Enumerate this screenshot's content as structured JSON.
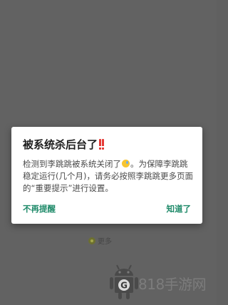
{
  "dialog": {
    "title": "被系统杀后台了",
    "title_icon": "double-exclamation-icon",
    "message_part1": "检测到李跳跳被系统关闭了",
    "message_emoji": "sweat-smile-emoji",
    "message_part2": "。为保障李跳跳稳定运行(几个月)，请务必按照李跳跳更多页面的“重要提示”进行设置。",
    "negative_button": "不再提醒",
    "positive_button": "知道了",
    "accent_color": "#1e8a69"
  },
  "background": {
    "more_label": "更多"
  },
  "watermark": {
    "text": "818手游网",
    "logo_letter": "G"
  }
}
